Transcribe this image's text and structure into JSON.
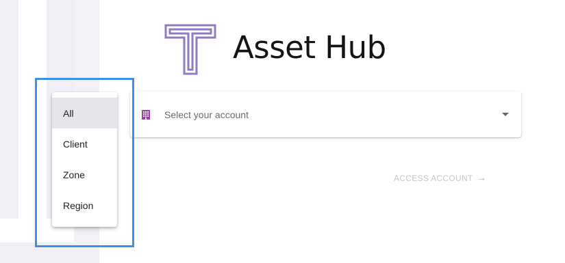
{
  "brand": {
    "name": "Asset Hub",
    "logo_icon": "t-letter-logo-icon",
    "logo_color": "#8e7bc2"
  },
  "account_select": {
    "placeholder": "Select your account",
    "icon": "building-icon",
    "icon_color": "#a23bb5"
  },
  "access_button": {
    "label": "ACCESS ACCOUNT",
    "icon": "arrow-right-icon",
    "arrow": "→",
    "enabled": false
  },
  "filter_menu": {
    "items": [
      {
        "label": "All",
        "selected": true
      },
      {
        "label": "Client",
        "selected": false
      },
      {
        "label": "Zone",
        "selected": false
      },
      {
        "label": "Region",
        "selected": false
      }
    ]
  },
  "highlight_color": "#3d8fea"
}
